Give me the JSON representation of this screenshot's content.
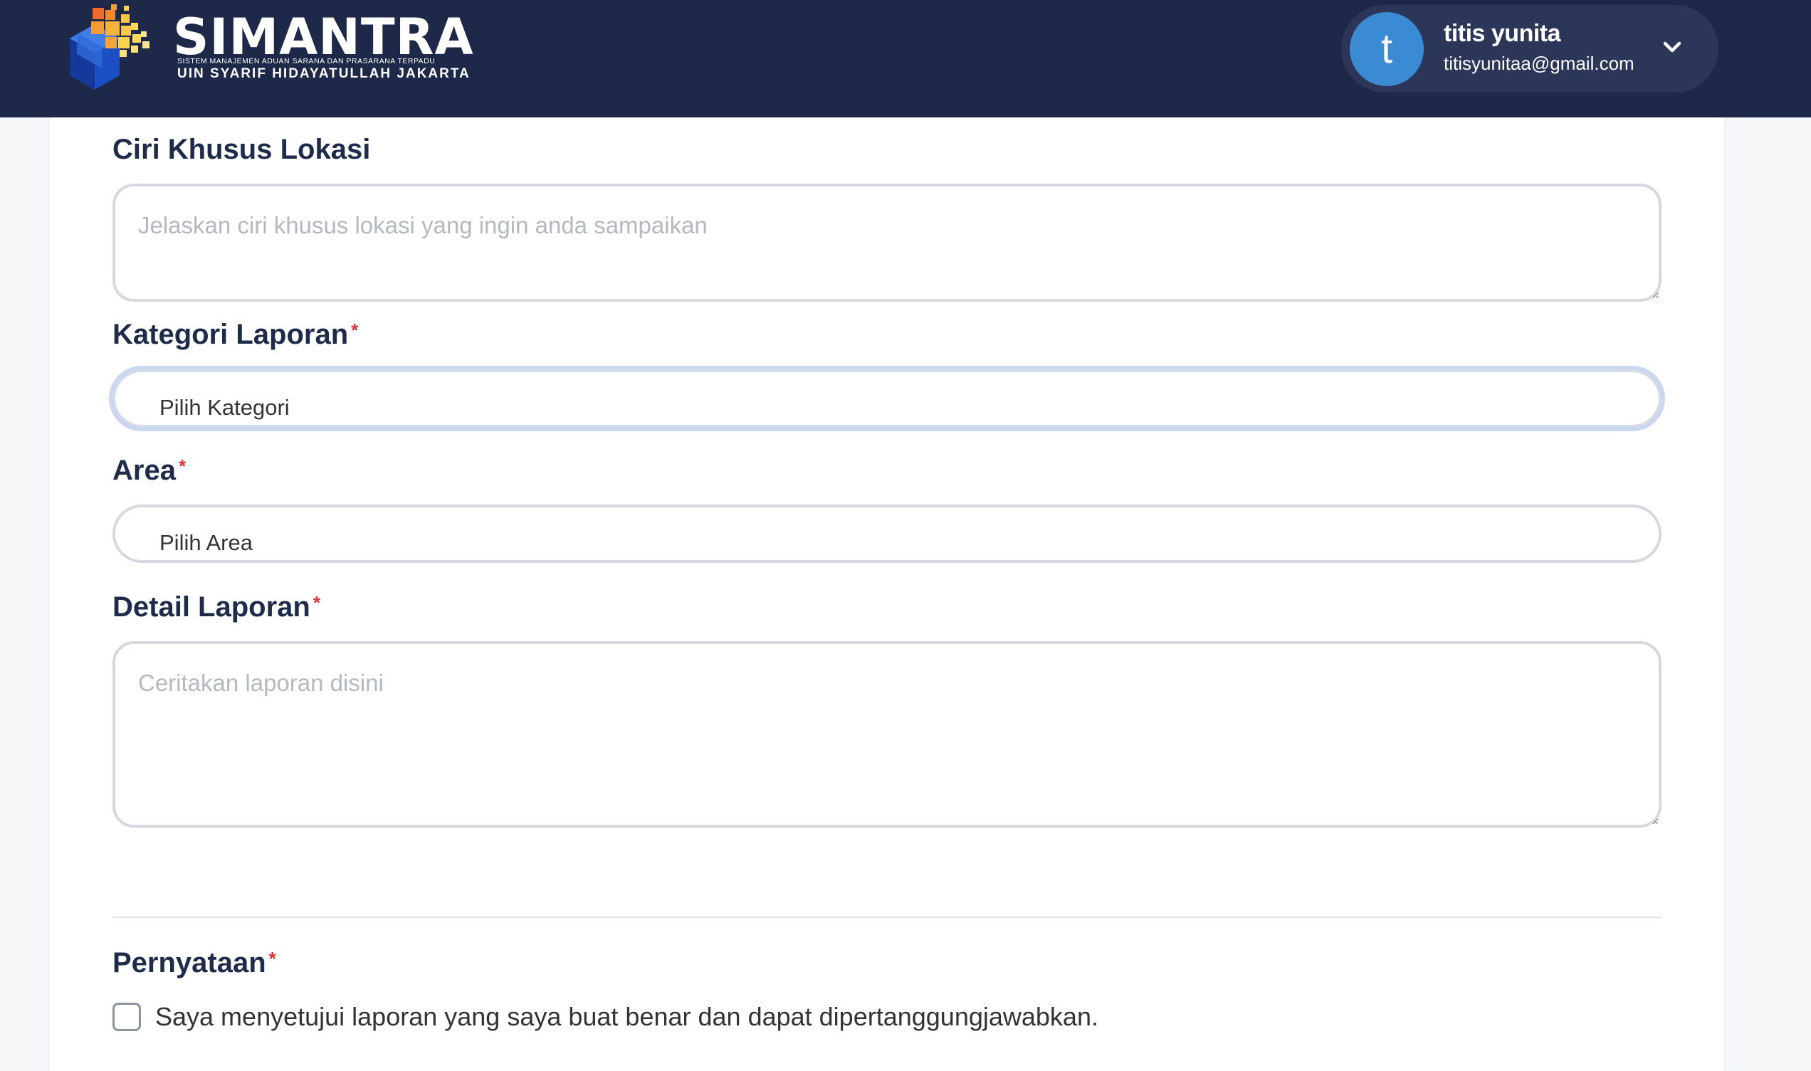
{
  "header": {
    "brand": {
      "name": "SIMANTRA",
      "tagline": "SISTEM MANAJEMEN ADUAN SARANA DAN PRASARANA TERPADU",
      "institution": "UIN SYARIF HIDAYATULLAH JAKARTA"
    },
    "user": {
      "avatar_initial": "t",
      "name": "titis yunita",
      "email": "titisyunitaa@gmail.com",
      "menu_icon": "chevron-down-icon"
    }
  },
  "form": {
    "ciri_khusus": {
      "label": "Ciri Khusus Lokasi",
      "placeholder": "Jelaskan ciri khusus lokasi yang ingin anda sampaikan"
    },
    "kategori": {
      "label": "Kategori Laporan",
      "required_mark": "*",
      "value": "Pilih Kategori"
    },
    "area": {
      "label": "Area",
      "required_mark": "*",
      "value": "Pilih Area"
    },
    "detail": {
      "label": "Detail Laporan",
      "required_mark": "*",
      "placeholder": "Ceritakan laporan disini"
    },
    "pernyataan": {
      "label": "Pernyataan",
      "required_mark": "*",
      "checkbox_label": "Saya menyetujui laporan yang saya buat benar dan dapat dipertanggungjawabkan.",
      "checked": false
    }
  },
  "colors": {
    "header_bg": "#1e2849",
    "user_pill_bg": "#2c3658",
    "avatar_bg": "#3a8bd4",
    "label_text": "#1f2b4a",
    "required": "#e03131",
    "field_border": "#d5d9df",
    "focus_ring": "#c9d8f0"
  }
}
